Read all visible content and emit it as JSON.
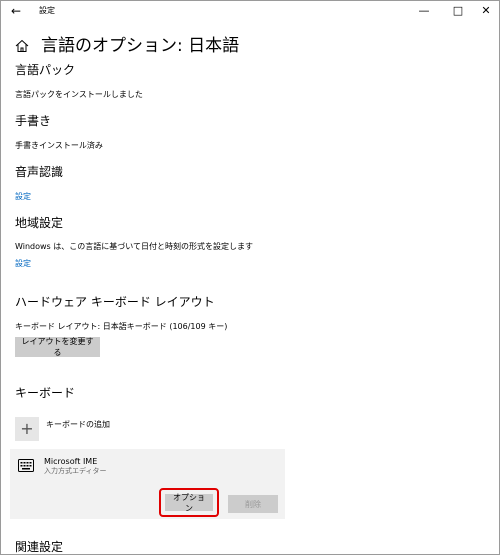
{
  "window": {
    "title": "設定",
    "back_glyph": "←",
    "minimize_glyph": "—",
    "maximize_glyph": "□",
    "close_glyph": "✕"
  },
  "header": {
    "icon": "home-icon",
    "title": "言語のオプション: 日本語"
  },
  "language_pack": {
    "title": "言語パック",
    "status": "言語パックをインストールしました"
  },
  "handwriting": {
    "title": "手書き",
    "status": "手書きインストール済み"
  },
  "speech": {
    "title": "音声認識",
    "settings_link": "設定"
  },
  "region": {
    "title": "地域設定",
    "description": "Windows は、この言語に基づいて日付と時刻の形式を設定します",
    "settings_link": "設定"
  },
  "hardware_keyboard": {
    "title": "ハードウェア キーボード レイアウト",
    "layout_text": "キーボード レイアウト:  日本語キーボード (106/109 キー)",
    "change_button": "レイアウトを変更する"
  },
  "keyboards": {
    "title": "キーボード",
    "add_label": "キーボードの追加",
    "add_glyph": "+",
    "items": [
      {
        "name": "Microsoft IME",
        "subtitle": "入力方式エディター",
        "options_button": "オプション",
        "remove_button": "削除"
      }
    ]
  },
  "related": {
    "title": "関連設定"
  },
  "colors": {
    "accent_link": "#0067c0",
    "highlight": "#e00000",
    "button_bg": "#cccccc",
    "card_bg": "#f2f2f2"
  }
}
